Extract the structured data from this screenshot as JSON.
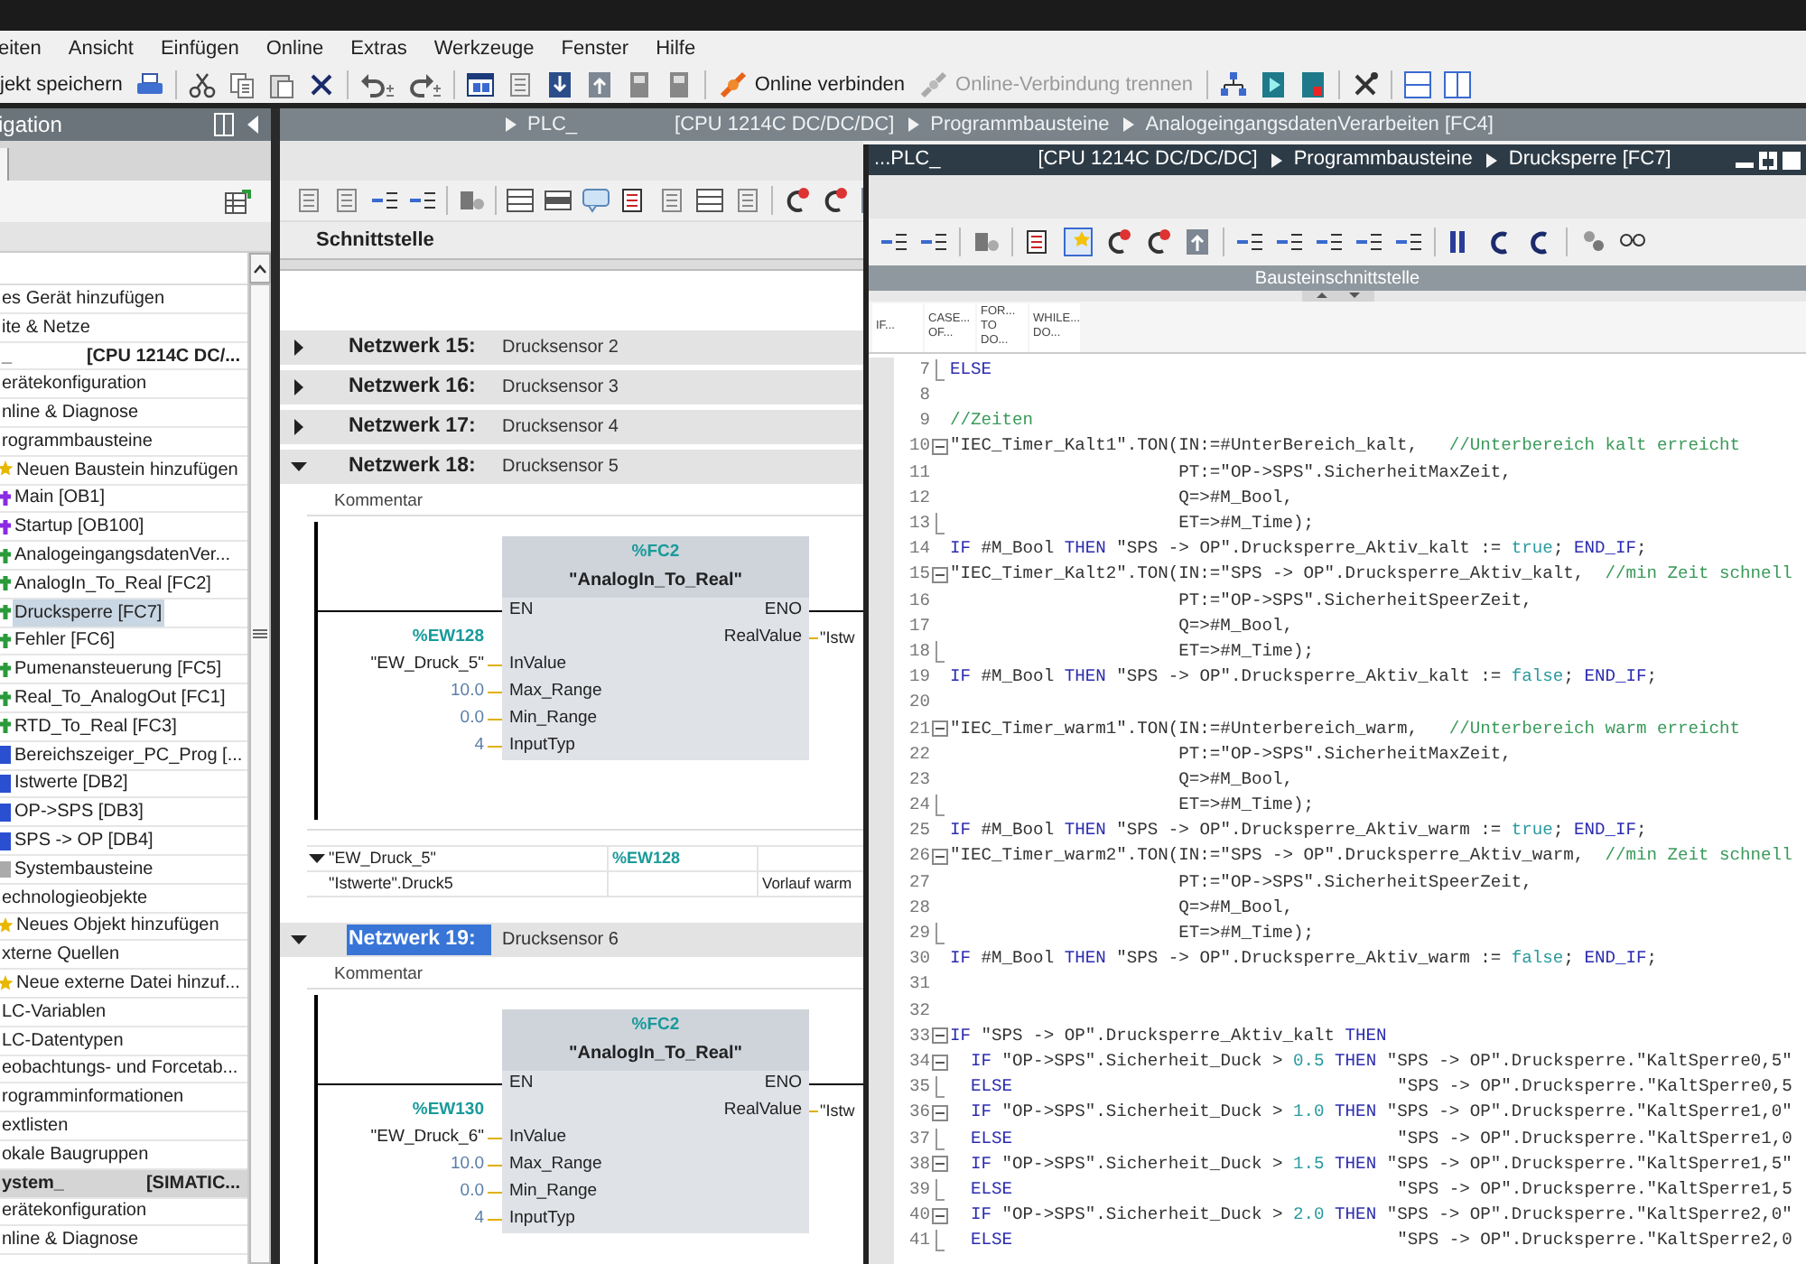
{
  "menu": [
    "eiten",
    "Ansicht",
    "Einfügen",
    "Online",
    "Extras",
    "Werkzeuge",
    "Fenster",
    "Hilfe"
  ],
  "toolbar": [
    {
      "label": "jekt speichern",
      "disabled": false
    },
    {
      "label": "Online verbinden",
      "disabled": false
    },
    {
      "label": "Online-Verbindung trennen",
      "disabled": true
    }
  ],
  "navigation": {
    "title": "igation",
    "tree": [
      {
        "label": "es Gerät hinzufügen",
        "selected": false,
        "highlighted": false
      },
      {
        "label": "ite & Netze",
        "selected": false,
        "highlighted": false
      },
      {
        "label": "_",
        "detail": "[CPU 1214C DC/...",
        "selected": false,
        "highlighted": false,
        "children": [
          {
            "label": "erätekonfiguration",
            "selected": false
          },
          {
            "label": "nline & Diagnose",
            "selected": false
          },
          {
            "label": "rogrammbausteine",
            "selected": false,
            "children": [
              {
                "label": "Neuen Baustein hinzufügen",
                "kind": "add",
                "selected": false
              },
              {
                "label": "Main [OB1]",
                "kind": "ob",
                "selected": false
              },
              {
                "label": "Startup [OB100]",
                "kind": "ob",
                "selected": false
              },
              {
                "label": "AnalogeingangsdatenVer...",
                "kind": "fc",
                "selected": false
              },
              {
                "label": "AnalogIn_To_Real [FC2]",
                "kind": "fc",
                "selected": false
              },
              {
                "label": "Drucksperre [FC7]",
                "kind": "fc",
                "selected": true
              },
              {
                "label": "Fehler [FC6]",
                "kind": "fc",
                "selected": false
              },
              {
                "label": "Pumenansteuerung [FC5]",
                "kind": "fc",
                "selected": false
              },
              {
                "label": "Real_To_AnalogOut [FC1]",
                "kind": "fc",
                "selected": false
              },
              {
                "label": "RTD_To_Real [FC3]",
                "kind": "fc",
                "selected": false
              },
              {
                "label": "Bereichszeiger_PC_Prog [...",
                "kind": "db",
                "selected": false
              },
              {
                "label": "Istwerte [DB2]",
                "kind": "db",
                "selected": false
              },
              {
                "label": "OP->SPS [DB3]",
                "kind": "db",
                "selected": false
              },
              {
                "label": "SPS -> OP [DB4]",
                "kind": "db",
                "selected": false
              },
              {
                "label": "Systembausteine",
                "kind": "sys",
                "selected": false
              }
            ]
          },
          {
            "label": "echnologieobjekte",
            "selected": false,
            "children": [
              {
                "label": "Neues Objekt hinzufügen",
                "kind": "add",
                "selected": false
              }
            ]
          },
          {
            "label": "xterne Quellen",
            "selected": false,
            "children": [
              {
                "label": "Neue externe Datei hinzuf...",
                "kind": "add",
                "selected": false
              }
            ]
          },
          {
            "label": "LC-Variablen",
            "selected": false
          },
          {
            "label": "LC-Datentypen",
            "selected": false
          },
          {
            "label": "eobachtungs- und Forcetab...",
            "selected": false
          },
          {
            "label": "rogramminformationen",
            "selected": false
          },
          {
            "label": "extlisten",
            "selected": false
          },
          {
            "label": "okale Baugruppen",
            "selected": false
          }
        ]
      },
      {
        "label": "ystem_",
        "detail": "[SIMATIC...",
        "selected": false,
        "highlighted": true,
        "children": [
          {
            "label": "erätekonfiguration",
            "selected": false
          },
          {
            "label": "nline & Diagnose",
            "selected": false
          }
        ]
      }
    ]
  },
  "editor": {
    "breadcrumb": [
      {
        "label": "PLC_",
        "arrow": true
      },
      {
        "label": "[CPU 1214C DC/DC/DC]",
        "arrow": false
      },
      {
        "label": "Programmbausteine",
        "arrow": true
      },
      {
        "label": "AnalogeingangsdatenVerarbeiten [FC4]",
        "arrow": true
      }
    ],
    "interface_label": "Schnittstelle",
    "networks": [
      {
        "label": "Netzwerk 15:",
        "title": "Drucksensor 2",
        "expanded": false,
        "highlighted": false
      },
      {
        "label": "Netzwerk 16:",
        "title": "Drucksensor 3",
        "expanded": false,
        "highlighted": false
      },
      {
        "label": "Netzwerk 17:",
        "title": "Drucksensor 4",
        "expanded": false,
        "highlighted": false
      },
      {
        "label": "Netzwerk 18:",
        "title": "Drucksensor 5",
        "expanded": true,
        "highlighted": false,
        "comment": "Kommentar",
        "block": {
          "address": "%FC2",
          "name": "\"AnalogIn_To_Real\"",
          "en": "EN",
          "eno": "ENO",
          "output": {
            "pin": "RealValue",
            "value": "\"Istw"
          },
          "inputs": [
            {
              "pin": "InValue",
              "value": "\"EW_Druck_5\"",
              "address": "%EW128",
              "kind": "tag"
            },
            {
              "pin": "Max_Range",
              "value": "10.0",
              "kind": "constant"
            },
            {
              "pin": "Min_Range",
              "value": "0.0",
              "kind": "constant"
            },
            {
              "pin": "InputTyp",
              "value": "4",
              "kind": "constant"
            }
          ]
        },
        "variables": {
          "expanded": true,
          "rows": [
            {
              "column_1": "\"EW_Druck_5\"",
              "column_2": "%EW128"
            },
            {
              "column_1": "\"Istwerte\".Druck5",
              "column_3": "Vorlauf warm"
            }
          ]
        }
      },
      {
        "label": "Netzwerk 19:",
        "title": "Drucksensor 6",
        "expanded": true,
        "highlighted": true,
        "comment": "Kommentar",
        "block": {
          "address": "%FC2",
          "name": "\"AnalogIn_To_Real\"",
          "en": "EN",
          "eno": "ENO",
          "output": {
            "pin": "RealValue",
            "value": "\"Istw"
          },
          "inputs": [
            {
              "pin": "InValue",
              "value": "\"EW_Druck_6\"",
              "address": "%EW130",
              "kind": "tag"
            },
            {
              "pin": "Max_Range",
              "value": "10.0",
              "kind": "constant"
            },
            {
              "pin": "Min_Range",
              "value": "0.0",
              "kind": "constant"
            },
            {
              "pin": "InputTyp",
              "value": "4",
              "kind": "constant"
            }
          ]
        }
      }
    ]
  },
  "code_window": {
    "breadcrumb": [
      {
        "label": "...PLC_",
        "arrow": false
      },
      {
        "label": "[CPU 1214C DC/DC/DC]",
        "arrow": false
      },
      {
        "label": "Programmbausteine",
        "arrow": true
      },
      {
        "label": "Drucksperre [FC7]",
        "arrow": true
      }
    ],
    "interface_label": "Bausteinschnittstelle",
    "palette": [
      "IF...",
      "CASE... OF...",
      "FOR... TO DO...",
      "WHILE... DO..."
    ],
    "lines": [
      {
        "number": "7",
        "text": "ELSE",
        "kind": "end"
      },
      {
        "number": "8",
        "kind": "plain"
      },
      {
        "number": "9",
        "text": "//Zeiten",
        "kind": "plain"
      },
      {
        "number": "10",
        "text": "\"IEC_Timer_Kalt1\".TON(IN:=#UnterBereich_kalt,   //Unterbereich kalt erreicht",
        "kind": "start"
      },
      {
        "number": "11",
        "text": "                      PT:=\"OP->SPS\".SicherheitMaxZeit,",
        "kind": "plain"
      },
      {
        "number": "12",
        "text": "                      Q=>#M_Bool,",
        "kind": "plain"
      },
      {
        "number": "13",
        "text": "                      ET=>#M_Time);",
        "kind": "end"
      },
      {
        "number": "14",
        "text": "IF #M_Bool THEN \"SPS -> OP\".Drucksperre_Aktiv_kalt := true; END_IF;",
        "kind": "plain"
      },
      {
        "number": "15",
        "text": "\"IEC_Timer_Kalt2\".TON(IN:=\"SPS -> OP\".Drucksperre_Aktiv_kalt,  //min Zeit schnell",
        "kind": "start"
      },
      {
        "number": "16",
        "text": "                      PT:=\"OP->SPS\".SicherheitSpeerZeit,",
        "kind": "plain"
      },
      {
        "number": "17",
        "text": "                      Q=>#M_Bool,",
        "kind": "plain"
      },
      {
        "number": "18",
        "text": "                      ET=>#M_Time);",
        "kind": "end"
      },
      {
        "number": "19",
        "text": "IF #M_Bool THEN \"SPS -> OP\".Drucksperre_Aktiv_kalt := false; END_IF;",
        "kind": "plain"
      },
      {
        "number": "20",
        "kind": "plain"
      },
      {
        "number": "21",
        "text": "\"IEC_Timer_warm1\".TON(IN:=#Unterbereich_warm,   //Unterbereich warm erreicht",
        "kind": "start"
      },
      {
        "number": "22",
        "text": "                      PT:=\"OP->SPS\".SicherheitMaxZeit,",
        "kind": "plain"
      },
      {
        "number": "23",
        "text": "                      Q=>#M_Bool,",
        "kind": "plain"
      },
      {
        "number": "24",
        "text": "                      ET=>#M_Time);",
        "kind": "end"
      },
      {
        "number": "25",
        "text": "IF #M_Bool THEN \"SPS -> OP\".Drucksperre_Aktiv_warm := true; END_IF;",
        "kind": "plain"
      },
      {
        "number": "26",
        "text": "\"IEC_Timer_warm2\".TON(IN:=\"SPS -> OP\".Drucksperre_Aktiv_warm,  //min Zeit schnell",
        "kind": "start"
      },
      {
        "number": "27",
        "text": "                      PT:=\"OP->SPS\".SicherheitSpeerZeit,",
        "kind": "plain"
      },
      {
        "number": "28",
        "text": "                      Q=>#M_Bool,",
        "kind": "plain"
      },
      {
        "number": "29",
        "text": "                      ET=>#M_Time);",
        "kind": "end"
      },
      {
        "number": "30",
        "text": "IF #M_Bool THEN \"SPS -> OP\".Drucksperre_Aktiv_warm := false; END_IF;",
        "kind": "plain"
      },
      {
        "number": "31",
        "kind": "plain"
      },
      {
        "number": "32",
        "kind": "plain"
      },
      {
        "number": "33",
        "text": "IF \"SPS -> OP\".Drucksperre_Aktiv_kalt THEN",
        "kind": "start"
      },
      {
        "number": "34",
        "text": "  IF \"OP->SPS\".Sicherheit_Duck > 0.5 THEN \"SPS -> OP\".Drucksperre.\"KaltSperre0,5\"",
        "kind": "start"
      },
      {
        "number": "35",
        "text": "  ELSE                                     \"SPS -> OP\".Drucksperre.\"KaltSperre0,5",
        "kind": "end"
      },
      {
        "number": "36",
        "text": "  IF \"OP->SPS\".Sicherheit_Duck > 1.0 THEN \"SPS -> OP\".Drucksperre.\"KaltSperre1,0\"",
        "kind": "start"
      },
      {
        "number": "37",
        "text": "  ELSE                                     \"SPS -> OP\".Drucksperre.\"KaltSperre1,0",
        "kind": "end"
      },
      {
        "number": "38",
        "text": "  IF \"OP->SPS\".Sicherheit_Duck > 1.5 THEN \"SPS -> OP\".Drucksperre.\"KaltSperre1,5\"",
        "kind": "start"
      },
      {
        "number": "39",
        "text": "  ELSE                                     \"SPS -> OP\".Drucksperre.\"KaltSperre1,5",
        "kind": "end"
      },
      {
        "number": "40",
        "text": "  IF \"OP->SPS\".Sicherheit_Duck > 2.0 THEN \"SPS -> OP\".Drucksperre.\"KaltSperre2,0\"",
        "kind": "start"
      },
      {
        "number": "41",
        "text": "  ELSE                                     \"SPS -> OP\".Drucksperre.\"KaltSperre2,0",
        "kind": "end"
      }
    ]
  }
}
